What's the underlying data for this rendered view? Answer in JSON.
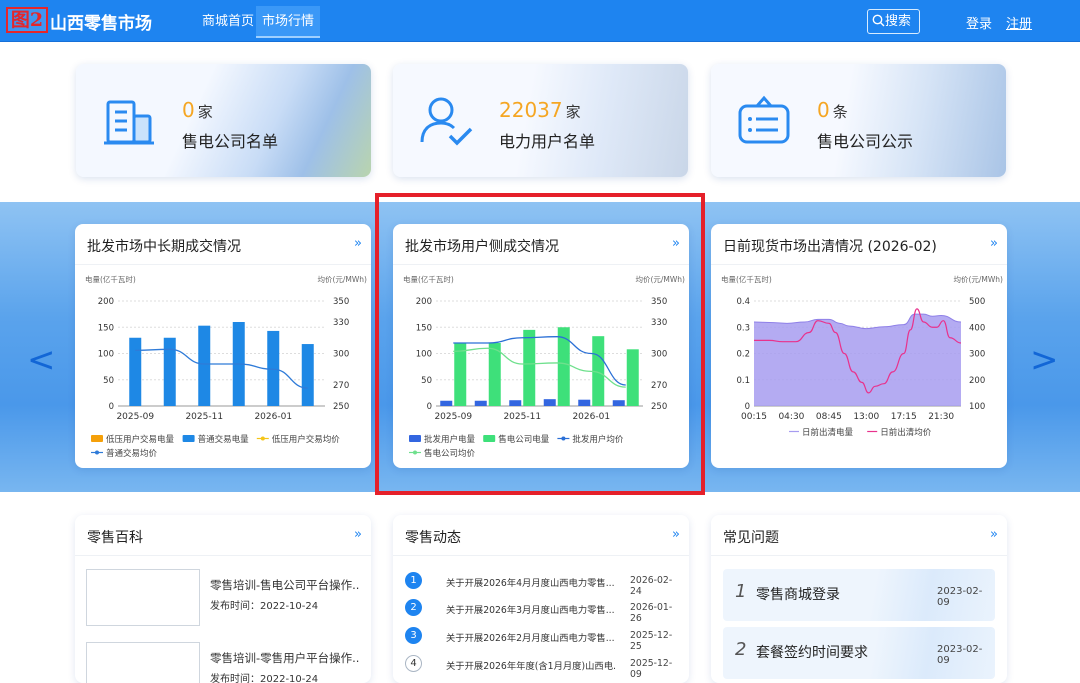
{
  "header": {
    "badge": "图2",
    "site_name": "山西零售市场",
    "nav": [
      "商城首页",
      "市场行情"
    ],
    "search_label": "搜索",
    "login": "登录",
    "register": "注册"
  },
  "stats": [
    {
      "count": "0",
      "unit": "家",
      "label": "售电公司名单",
      "icon": "building-icon"
    },
    {
      "count": "22037",
      "unit": "家",
      "label": "电力用户名单",
      "icon": "user-check-icon"
    },
    {
      "count": "0",
      "unit": "条",
      "label": "售电公司公示",
      "icon": "notice-board-icon"
    }
  ],
  "nav_arrows": {
    "prev": "<",
    "next": ">"
  },
  "more_icon": "»",
  "colors": {
    "primary": "#1e84f0",
    "highlight_border": "#e5202a",
    "accent_orange": "#f5a623"
  },
  "charts": [
    {
      "title": "批发市场中长期成交情况",
      "y_left_unit": "电量(亿千瓦时)",
      "y_right_unit": "均价(元/MWh)"
    },
    {
      "title": "批发市场用户侧成交情况",
      "y_left_unit": "电量(亿千瓦时)",
      "y_right_unit": "均价(元/MWh)"
    },
    {
      "title": "日前现货市场出清情况 (2026-02)",
      "y_left_unit": "电量(亿千瓦时)",
      "y_right_unit": "均价(元/MWh)"
    }
  ],
  "chart_data": [
    {
      "type": "bar",
      "title": "批发市场中长期成交情况",
      "categories": [
        "2025-09",
        "2025-10",
        "2025-11",
        "2025-12",
        "2026-01",
        "2026-02"
      ],
      "x_tick_labels": [
        "2025-09",
        "2025-11",
        "2026-01"
      ],
      "ylabel": "电量(亿千瓦时)",
      "ylim": [
        0,
        200
      ],
      "y_ticks": [
        "0",
        "50",
        "100",
        "150",
        "200"
      ],
      "y2label": "均价(元/MWh)",
      "y2lim": [
        250,
        350
      ],
      "y2_ticks": [
        "250",
        "270",
        "300",
        "330",
        "350"
      ],
      "series": [
        {
          "name": "低压用户交易电量",
          "kind": "bar",
          "color": "#f5a00a",
          "values": [
            0,
            0,
            0,
            0,
            0,
            0
          ]
        },
        {
          "name": "普通交易电量",
          "kind": "bar",
          "color": "#1e88e5",
          "values": [
            130,
            130,
            153,
            160,
            143,
            118
          ]
        },
        {
          "name": "低压用户交易均价",
          "kind": "line",
          "color": "#f5c518",
          "values": []
        },
        {
          "name": "普通交易均价",
          "kind": "line",
          "color": "#2f7bd8",
          "values": [
            303,
            304,
            290,
            290,
            285,
            267
          ]
        }
      ]
    },
    {
      "type": "bar",
      "title": "批发市场用户侧成交情况",
      "categories": [
        "2025-09",
        "2025-10",
        "2025-11",
        "2025-12",
        "2026-01",
        "2026-02"
      ],
      "x_tick_labels": [
        "2025-09",
        "2025-11",
        "2026-01"
      ],
      "ylabel": "电量(亿千瓦时)",
      "ylim": [
        0,
        200
      ],
      "y_ticks": [
        "0",
        "50",
        "100",
        "150",
        "200"
      ],
      "y2label": "均价(元/MWh)",
      "y2lim": [
        250,
        350
      ],
      "y2_ticks": [
        "250",
        "270",
        "300",
        "330",
        "350"
      ],
      "series": [
        {
          "name": "批发用户电量",
          "kind": "bar",
          "color": "#3366e0",
          "values": [
            10,
            10,
            11,
            13,
            12,
            11
          ]
        },
        {
          "name": "售电公司电量",
          "kind": "bar",
          "color": "#3ee07a",
          "values": [
            120,
            120,
            145,
            150,
            133,
            108
          ]
        },
        {
          "name": "批发用户均价",
          "kind": "line",
          "color": "#2a6fd6",
          "values": [
            310,
            310,
            315,
            316,
            300,
            270
          ]
        },
        {
          "name": "售电公司均价",
          "kind": "line",
          "color": "#6fe08d",
          "values": [
            302,
            305,
            290,
            291,
            283,
            268
          ]
        }
      ]
    },
    {
      "type": "area",
      "title": "日前现货市场出清情况 (2026-02)",
      "x_tick_labels": [
        "00:15",
        "04:30",
        "08:45",
        "13:00",
        "17:15",
        "21:30"
      ],
      "ylabel": "电量(亿千瓦时)",
      "ylim": [
        0,
        0.4
      ],
      "y_ticks": [
        "0",
        "0.1",
        "0.2",
        "0.3",
        "0.4"
      ],
      "y2label": "均价(元/MWh)",
      "y2lim": [
        100,
        500
      ],
      "y2_ticks": [
        "100",
        "200",
        "300",
        "400",
        "500"
      ],
      "series": [
        {
          "name": "日前出清电量",
          "kind": "area",
          "color": "#a79cf0",
          "x": [
            "00:15",
            "02:00",
            "04:00",
            "06:00",
            "07:30",
            "08:45",
            "10:00",
            "11:00",
            "13:00",
            "15:00",
            "17:15",
            "18:30",
            "19:30",
            "20:30",
            "21:30",
            "23:45"
          ],
          "values": [
            0.32,
            0.318,
            0.315,
            0.32,
            0.33,
            0.33,
            0.315,
            0.305,
            0.295,
            0.302,
            0.31,
            0.35,
            0.35,
            0.342,
            0.345,
            0.32
          ]
        },
        {
          "name": "日前出清均价",
          "kind": "line",
          "color": "#e8328c",
          "x": [
            "00:15",
            "02:00",
            "03:30",
            "05:00",
            "06:30",
            "07:30",
            "08:45",
            "09:30",
            "10:30",
            "11:30",
            "12:30",
            "13:15",
            "14:00",
            "15:00",
            "16:00",
            "17:15",
            "18:00",
            "18:45",
            "19:30",
            "20:30",
            "21:00",
            "21:45",
            "22:30",
            "23:45"
          ],
          "values": [
            350,
            350,
            345,
            345,
            380,
            425,
            415,
            380,
            300,
            230,
            190,
            150,
            175,
            185,
            230,
            300,
            390,
            470,
            420,
            400,
            400,
            425,
            360,
            340
          ]
        }
      ]
    }
  ],
  "retail_wiki": {
    "title": "零售百科",
    "items": [
      {
        "title": "零售培训-售电公司平台操作...",
        "date": "发布时间：2022-10-24"
      },
      {
        "title": "零售培训-零售用户平台操作...",
        "date": "发布时间：2022-10-24"
      }
    ]
  },
  "retail_news": {
    "title": "零售动态",
    "items": [
      {
        "num": "1",
        "title": "关于开展2026年4月月度山西电力零售...",
        "date": "2026-02-24"
      },
      {
        "num": "2",
        "title": "关于开展2026年3月月度山西电力零售...",
        "date": "2026-01-26"
      },
      {
        "num": "3",
        "title": "关于开展2026年2月月度山西电力零售...",
        "date": "2025-12-25"
      },
      {
        "num": "4",
        "title": "关于开展2026年年度(含1月月度)山西电...",
        "date": "2025-12-09"
      }
    ]
  },
  "faq": {
    "title": "常见问题",
    "items": [
      {
        "num": "1",
        "title": "零售商城登录",
        "date": "2023-02-09"
      },
      {
        "num": "2",
        "title": "套餐签约时间要求",
        "date": "2023-02-09"
      }
    ]
  }
}
